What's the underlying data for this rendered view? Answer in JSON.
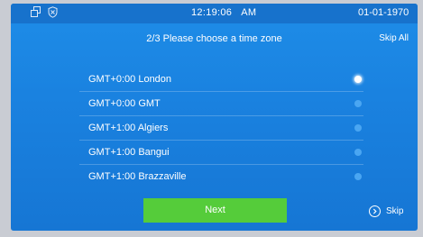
{
  "status_bar": {
    "icons": [
      "windows-icon",
      "shield-icon"
    ],
    "time": "12:19:06",
    "ampm": "AM",
    "date": "01-01-1970"
  },
  "header": {
    "title": "2/3 Please choose a time zone",
    "skip_all_label": "Skip All"
  },
  "timezones": [
    {
      "label": "GMT+0:00 London",
      "selected": true
    },
    {
      "label": "GMT+0:00 GMT",
      "selected": false
    },
    {
      "label": "GMT+1:00 Algiers",
      "selected": false
    },
    {
      "label": "GMT+1:00 Bangui",
      "selected": false
    },
    {
      "label": "GMT+1:00 Brazzaville",
      "selected": false
    }
  ],
  "footer": {
    "next_label": "Next",
    "skip_label": "Skip",
    "skip_icon": "chevron-right-circle-icon"
  },
  "colors": {
    "background": "#1a82e0",
    "next_button": "#55cc3a",
    "radio_unselected": "#4aa6f2",
    "radio_selected": "#ffffff"
  }
}
